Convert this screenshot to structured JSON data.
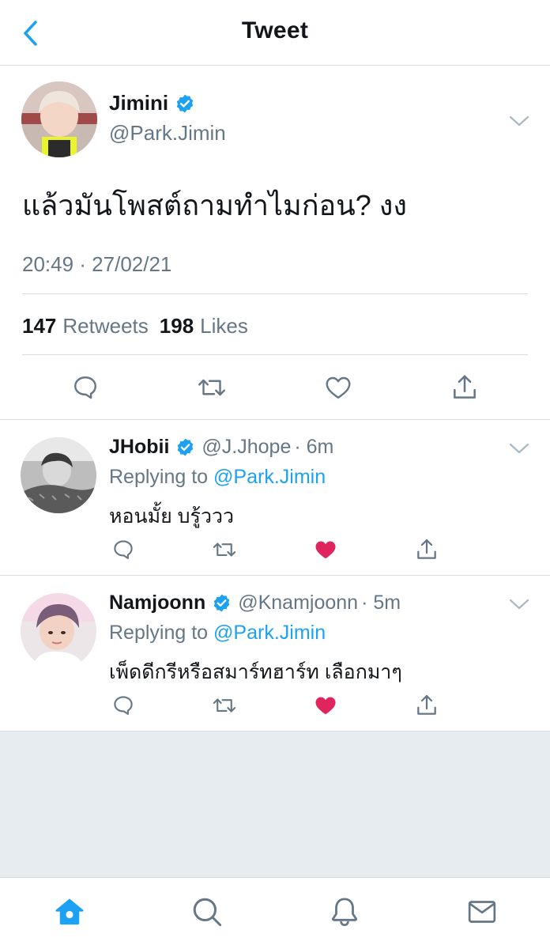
{
  "header": {
    "title": "Tweet"
  },
  "main_tweet": {
    "author_name": "Jimini",
    "author_handle": "@Park.Jimin",
    "text": "แล้วมันโพสต์ถามทำไมก่อน? งง",
    "timestamp": "20:49 · 27/02/21",
    "retweets_count": "147",
    "retweets_label": "Retweets",
    "likes_count": "198",
    "likes_label": "Likes",
    "liked": false
  },
  "replies": [
    {
      "author_name": "JHobii",
      "author_handle": "@J.Jhope",
      "time": "· 6m",
      "replying_label": "Replying to",
      "replying_to": "@Park.Jimin",
      "text": "หอนมั้ย บรู้ววว",
      "liked": true
    },
    {
      "author_name": "Namjoonn",
      "author_handle": "@Knamjoonn",
      "time": "· 5m",
      "replying_label": "Replying to",
      "replying_to": "@Park.Jimin",
      "text": "เพ็ดดีกรีหรือสมาร์ทฮาร์ท เลือกมาๆ",
      "liked": true
    }
  ],
  "icons": {
    "back": "chevron-left-icon",
    "verified": "verified-badge-icon",
    "more": "chevron-down-icon",
    "reply": "comment-icon",
    "retweet": "retweet-icon",
    "like": "heart-icon",
    "share": "share-icon",
    "home": "home-icon",
    "search": "search-icon",
    "notifications": "bell-icon",
    "messages": "mail-icon"
  },
  "colors": {
    "accent": "#1da1f2",
    "like_active": "#e0245e",
    "secondary_text": "#657786",
    "icon_gray": "#657786",
    "empty_bg": "#e6ecf0"
  },
  "tabbar": {
    "active": "home"
  }
}
